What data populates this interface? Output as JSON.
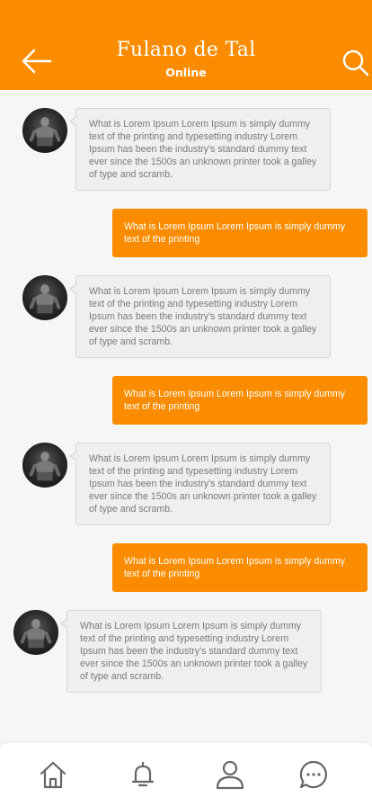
{
  "header": {
    "title": "Fulano de Tal",
    "status": "Online",
    "background_color": "#fb8c00",
    "back_icon": "arrow-left-icon",
    "search_icon": "search-icon"
  },
  "messages": [
    {
      "direction": "incoming",
      "text": "What is Lorem Ipsum Lorem Ipsum is simply dummy text of the printing and typesetting industry Lorem Ipsum has been the industry's standard dummy text ever since the 1500s an unknown printer took a galley of type and scramb."
    },
    {
      "direction": "outgoing",
      "text": "What is Lorem Ipsum Lorem Ipsum is simply dummy text of the printing"
    },
    {
      "direction": "incoming",
      "text": "What is Lorem Ipsum Lorem Ipsum is simply dummy text of the printing and typesetting industry Lorem Ipsum has been the industry's standard dummy text ever since the 1500s an unknown printer took a galley of type and scramb."
    },
    {
      "direction": "outgoing",
      "text": "What is Lorem Ipsum Lorem Ipsum is simply dummy text of the printing"
    },
    {
      "direction": "incoming",
      "text": "What is Lorem Ipsum Lorem Ipsum is simply dummy text of the printing and typesetting industry Lorem Ipsum has been the industry's standard dummy text ever since the 1500s an unknown printer took a galley of type and scramb."
    },
    {
      "direction": "outgoing",
      "text": "What is Lorem Ipsum Lorem Ipsum is simply dummy text of the printing"
    },
    {
      "direction": "incoming",
      "text": "What is Lorem Ipsum Lorem Ipsum is simply dummy text of the printing and typesetting industry Lorem Ipsum has been the industry's standard dummy text ever since the 1500s an unknown printer took a galley of type and scramb."
    }
  ],
  "bottom_nav": {
    "items": [
      {
        "icon": "home-icon"
      },
      {
        "icon": "bell-icon"
      },
      {
        "icon": "user-icon"
      },
      {
        "icon": "chat-icon"
      }
    ]
  }
}
